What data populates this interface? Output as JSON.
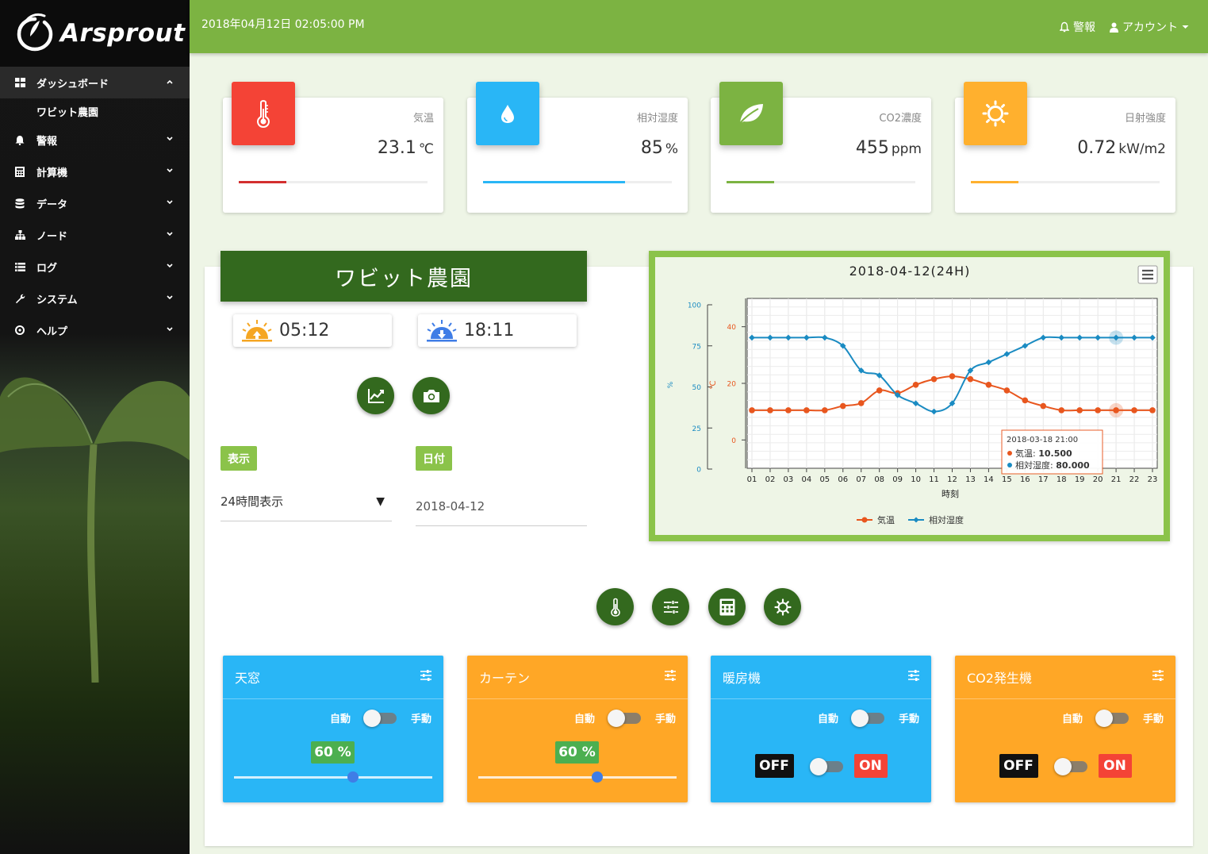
{
  "app": {
    "logo_text": "Arsprout"
  },
  "sidebar": {
    "items": [
      {
        "label": "ダッシュボード",
        "icon": "dashboard-icon",
        "active": true,
        "sub": [
          "ワビット農園"
        ]
      },
      {
        "label": "警報",
        "icon": "bell-icon"
      },
      {
        "label": "計算機",
        "icon": "calculator-icon"
      },
      {
        "label": "データ",
        "icon": "database-icon"
      },
      {
        "label": "ノード",
        "icon": "sitemap-icon"
      },
      {
        "label": "ログ",
        "icon": "list-icon"
      },
      {
        "label": "システム",
        "icon": "wrench-icon"
      },
      {
        "label": "ヘルプ",
        "icon": "help-icon"
      }
    ]
  },
  "header": {
    "datetime": "2018年04月12日 02:05:00 PM",
    "alert_label": "警報",
    "account_label": "アカウント"
  },
  "stats": [
    {
      "label": "気温",
      "value": "23.1",
      "unit": "℃",
      "color": "#f44336",
      "bar_color": "#d32f2f",
      "bar_fraction": 0.25,
      "icon": "thermometer-icon"
    },
    {
      "label": "相対湿度",
      "value": "85",
      "unit": "%",
      "color": "#29b6f6",
      "bar_color": "#29b6f6",
      "bar_fraction": 0.75,
      "icon": "water-drop-icon"
    },
    {
      "label": "CO2濃度",
      "value": "455",
      "unit": "ppm",
      "color": "#7cb342",
      "bar_color": "#7cb342",
      "bar_fraction": 0.25,
      "icon": "leaf-icon"
    },
    {
      "label": "日射強度",
      "value": "0.72",
      "unit": "kW/m2",
      "color": "#ffb02e",
      "bar_color": "#ffb02e",
      "bar_fraction": 0.25,
      "icon": "sun-icon"
    }
  ],
  "farm": {
    "name": "ワビット農園",
    "sunrise": "05:12",
    "sunset": "18:11",
    "display_tag": "表示",
    "date_tag": "日付",
    "display_value": "24時間表示",
    "date_value": "2018-04-12"
  },
  "chart_data": {
    "type": "line",
    "title": "2018-04-12(24H)",
    "xlabel": "時刻",
    "ylabel_left_outer": "%",
    "ylabel_left_inner": "℃",
    "categories": [
      "01",
      "02",
      "03",
      "04",
      "05",
      "06",
      "07",
      "08",
      "09",
      "10",
      "11",
      "12",
      "13",
      "14",
      "15",
      "16",
      "17",
      "18",
      "19",
      "20",
      "21",
      "22",
      "23"
    ],
    "series": [
      {
        "name": "気温",
        "axis": "temp",
        "color": "#e8561e",
        "values": [
          10.5,
          10.5,
          10.5,
          10.5,
          10.5,
          12.0,
          13.0,
          17.5,
          16.5,
          19.5,
          21.5,
          22.5,
          21.5,
          19.5,
          17.5,
          14.0,
          12.0,
          10.5,
          10.5,
          10.5,
          10.5,
          10.5,
          10.5
        ]
      },
      {
        "name": "相対湿度",
        "axis": "humidity",
        "color": "#1a8bc2",
        "values": [
          80,
          80,
          80,
          80,
          80,
          75,
          60,
          57,
          45,
          40,
          35,
          40,
          60,
          65,
          70,
          75,
          80,
          80,
          80,
          80,
          80,
          80,
          80
        ]
      }
    ],
    "temp_axis": {
      "ticks": [
        "0",
        "20",
        "40"
      ],
      "range": [
        -10,
        50
      ]
    },
    "humidity_axis": {
      "ticks": [
        "0",
        "25",
        "50",
        "75",
        "100"
      ],
      "range": [
        0,
        100
      ]
    },
    "tooltip": {
      "title": "2018-03-18 21:00",
      "temp_label": "気温",
      "temp_value": "10.500",
      "hum_label": "相対湿度",
      "hum_value": "80.000",
      "index": 20
    },
    "legend_placement": "bottom-center",
    "grid": true
  },
  "controls": [
    {
      "title": "天窓",
      "color": "blue",
      "auto_label": "自動",
      "manual_label": "手動",
      "type": "slider",
      "percent": "60 %",
      "value": 0.6
    },
    {
      "title": "カーテン",
      "color": "orange",
      "auto_label": "自動",
      "manual_label": "手動",
      "type": "slider",
      "percent": "60 %",
      "value": 0.6
    },
    {
      "title": "暖房機",
      "color": "blue",
      "auto_label": "自動",
      "manual_label": "手動",
      "type": "onoff",
      "off_label": "OFF",
      "on_label": "ON"
    },
    {
      "title": "CO2発生機",
      "color": "orange",
      "auto_label": "自動",
      "manual_label": "手動",
      "type": "onoff",
      "off_label": "OFF",
      "on_label": "ON"
    }
  ]
}
